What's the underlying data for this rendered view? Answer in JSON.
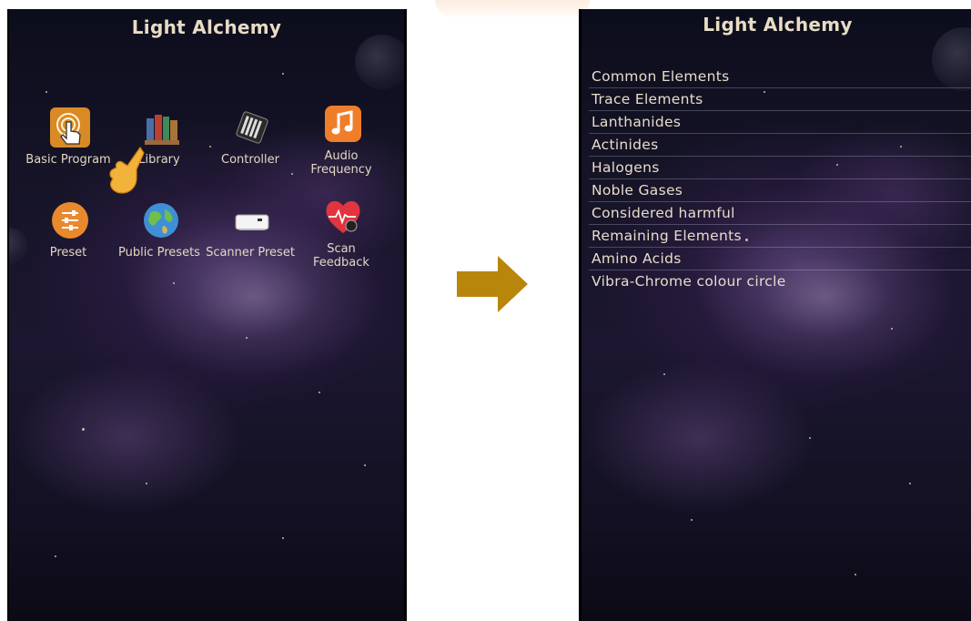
{
  "left_screen": {
    "title": "Light Alchemy",
    "tiles": [
      {
        "label": "Basic Program",
        "icon": "touch-hand-icon"
      },
      {
        "label": "Library",
        "icon": "books-icon"
      },
      {
        "label": "Controller",
        "icon": "controller-device-icon"
      },
      {
        "label": "Audio Frequency",
        "icon": "music-note-icon"
      },
      {
        "label": "Preset",
        "icon": "sliders-icon"
      },
      {
        "label": "Public Presets",
        "icon": "globe-icon"
      },
      {
        "label": "Scanner Preset",
        "icon": "scanner-device-icon"
      },
      {
        "label": "Scan Feedback",
        "icon": "heart-scan-icon"
      }
    ]
  },
  "transition": {
    "icon": "arrow-right-icon",
    "color": "#b8860b"
  },
  "right_screen": {
    "title": "Light Alchemy",
    "items": [
      "Common Elements",
      "Trace Elements",
      "Lanthanides",
      "Actinides",
      "Halogens",
      "Noble Gases",
      "Considered harmful",
      "Remaining Elements",
      "Amino Acids",
      "Vibra-Chrome colour circle"
    ]
  },
  "colors": {
    "title_text": "#e9dcc4",
    "list_text": "#e7dccb",
    "audio_icon_bg": "#f07d2a",
    "preset_icon_bg": "#e8892d",
    "basic_program_icon_bg": "#d98a25"
  }
}
